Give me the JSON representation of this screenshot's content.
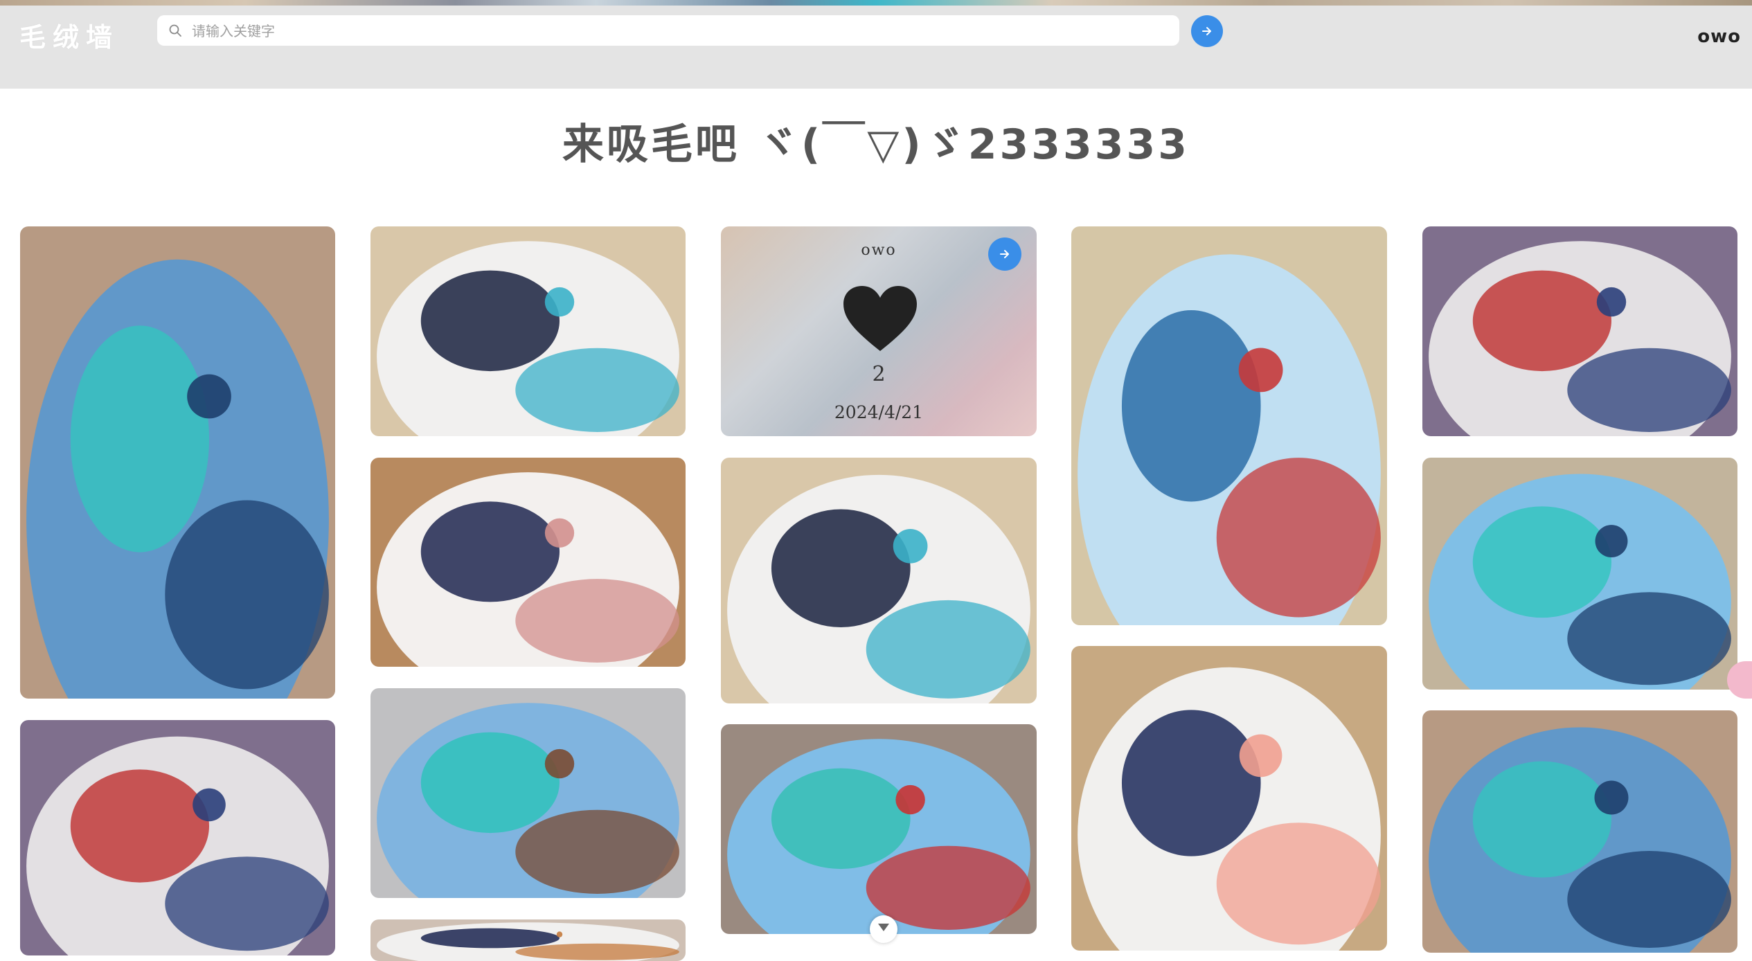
{
  "header": {
    "logo": "毛绒墙",
    "search_placeholder": "请输入关键字",
    "search_icon": "search-icon",
    "search_button_icon": "arrow-right-icon",
    "user": "owo"
  },
  "page_title": "来吸毛吧 ヾ(￣▽)ゞ2333333",
  "info_card": {
    "user": "owo",
    "likes": "2",
    "date": "2024/4/21",
    "heart_icon": "heart-icon",
    "go_icon": "arrow-right-icon"
  },
  "colors": {
    "accent": "#3a8ee8",
    "header_bg": "#e4e4e4",
    "title": "#555555"
  },
  "photos": [
    {
      "subject": "blue fursuit closeup",
      "palette": [
        "#b79a83",
        "#5c98cc",
        "#37c1c0",
        "#1e3f6d"
      ]
    },
    {
      "subject": "fursuits with ribbons",
      "palette": [
        "#7f6f8d",
        "#e9e6e8",
        "#c13a3a",
        "#2a3f7a"
      ]
    },
    {
      "subject": "white navy fursuit holding paw",
      "palette": [
        "#d9c7a9",
        "#f2f2f2",
        "#1a2240",
        "#3bb1c9"
      ]
    },
    {
      "subject": "white navy fursuit with bell",
      "palette": [
        "#b88a5f",
        "#f5f5f5",
        "#1f2750",
        "#d3908e"
      ]
    },
    {
      "subject": "blue fursuit lying",
      "palette": [
        "#c0c0c2",
        "#7cb3e0",
        "#2fc2bc",
        "#7a4b33"
      ]
    },
    {
      "subject": "two fursuits in hall",
      "palette": [
        "#cfc0b4",
        "#f2f2f2",
        "#1b2550",
        "#c47a3c"
      ]
    },
    {
      "subject": "white navy fursuit holding paw",
      "palette": [
        "#d9c7a9",
        "#f2f2f2",
        "#1a2240",
        "#3bb1c9"
      ]
    },
    {
      "subject": "blue fursuit covering face",
      "palette": [
        "#9a8a80",
        "#7ec0ec",
        "#36bfb4",
        "#c83333"
      ]
    },
    {
      "subject": "light blue fursuit",
      "palette": [
        "#d5c6a6",
        "#bfe0f5",
        "#2b6fa8",
        "#c73a3a"
      ]
    },
    {
      "subject": "fursuit paws closeup",
      "palette": [
        "#c7a982",
        "#f3f3f3",
        "#1d2a5a",
        "#f1a090"
      ]
    },
    {
      "subject": "fursuits with ribbons",
      "palette": [
        "#7f6f8d",
        "#e9e6e8",
        "#c13a3a",
        "#2a3f7a"
      ]
    },
    {
      "subject": "blue fursuit closeup",
      "palette": [
        "#c2b49c",
        "#7cc0ea",
        "#36c4c0",
        "#1e3f6d"
      ]
    }
  ]
}
